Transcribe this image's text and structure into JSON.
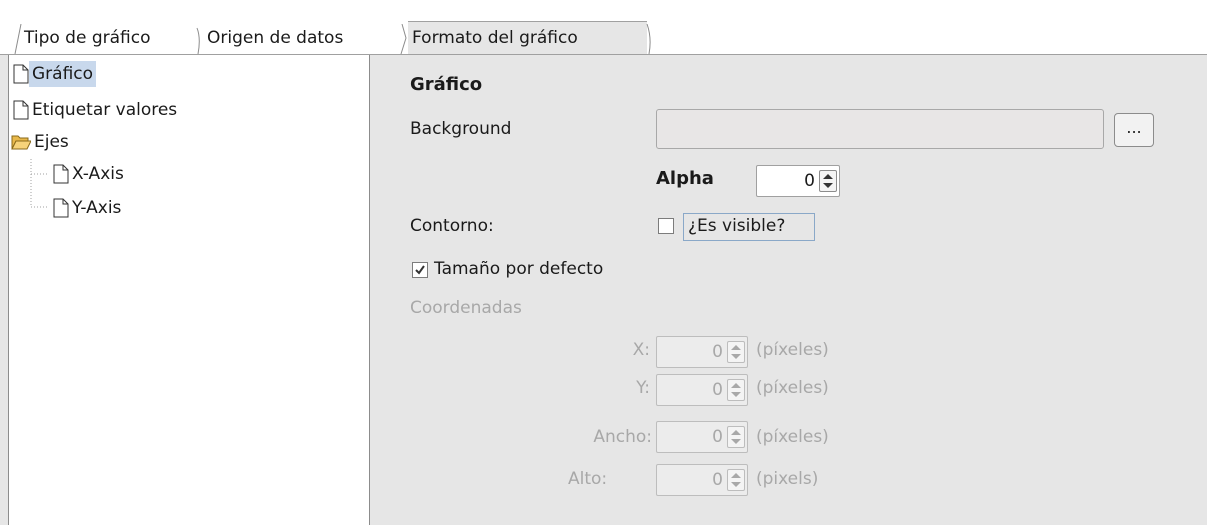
{
  "tabs": [
    {
      "label": "Tipo de gráfico",
      "active": false
    },
    {
      "label": "Origen de datos",
      "active": false
    },
    {
      "label": "Formato del gráfico",
      "active": true
    }
  ],
  "tree": {
    "items": [
      {
        "label": "Gráfico",
        "icon": "document-icon",
        "selected": true
      },
      {
        "label": "Etiquetar valores",
        "icon": "document-icon",
        "selected": false
      },
      {
        "label": "Ejes",
        "icon": "folder-open-icon",
        "selected": false
      },
      {
        "label": "X-Axis",
        "icon": "document-icon",
        "selected": false
      },
      {
        "label": "Y-Axis",
        "icon": "document-icon",
        "selected": false
      }
    ]
  },
  "form": {
    "title": "Gráfico",
    "background_label": "Background",
    "background_value": "",
    "browse_label": "...",
    "alpha_label": "Alpha",
    "alpha_value": "0",
    "outline_label": "Contorno:",
    "visible_label": "¿Es visible?",
    "visible_checked": false,
    "default_size_label": "Tamaño por defecto",
    "default_size_checked": true,
    "coords_label": "Coordenadas",
    "coords": [
      {
        "label": "X:",
        "value": "0",
        "unit": "(píxeles)"
      },
      {
        "label": "Y:",
        "value": "0",
        "unit": "(píxeles)"
      },
      {
        "label": "Ancho:",
        "value": "0",
        "unit": "(píxeles)"
      },
      {
        "label": "Alto:",
        "value": "0",
        "unit": "(pixels)"
      }
    ]
  },
  "colors": {
    "panel_bg": "#e6e6e6",
    "selection": "#c8d8ec",
    "disabled_text": "#a8a8a8"
  }
}
